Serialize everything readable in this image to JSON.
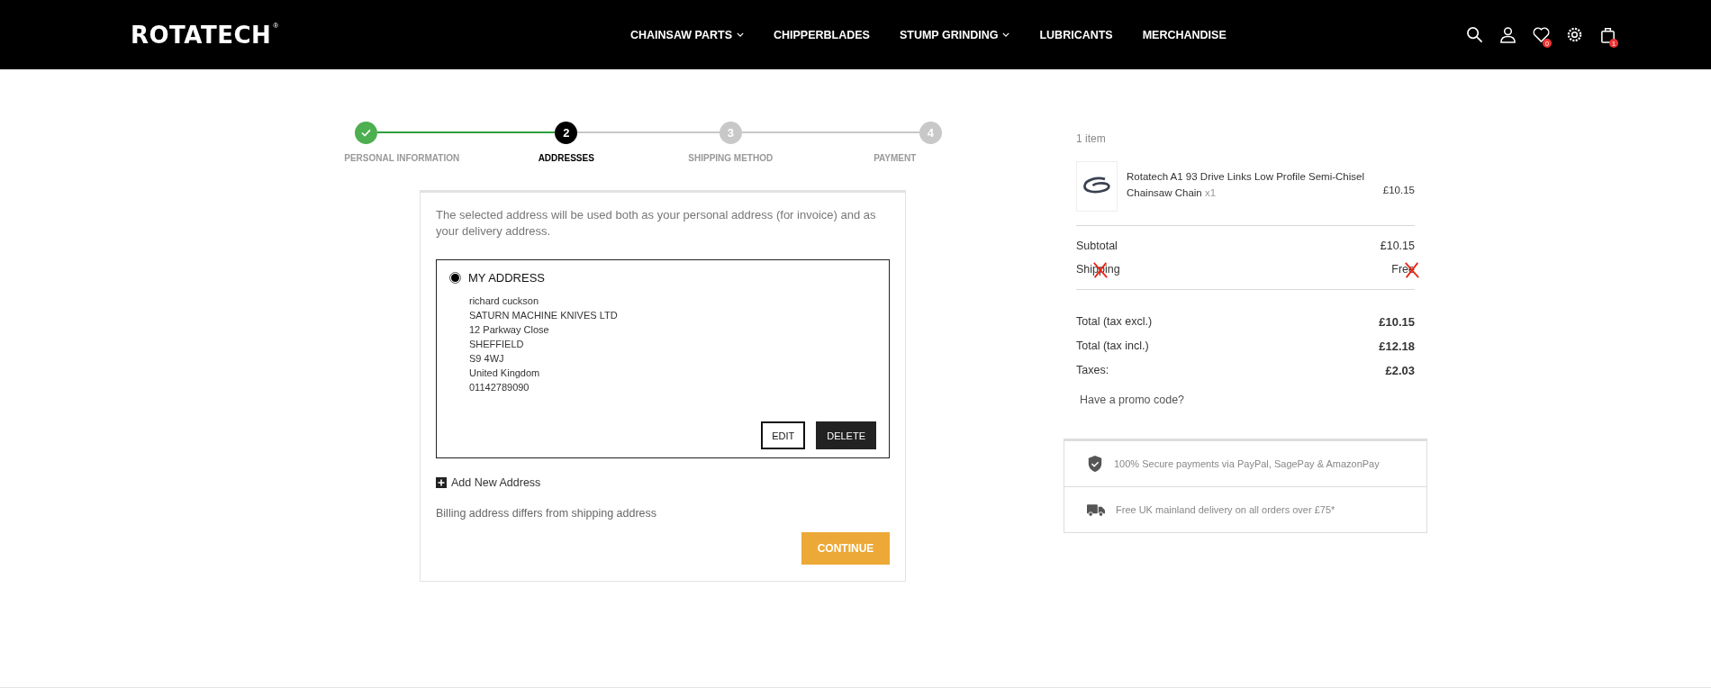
{
  "header": {
    "logo": "ROTATECH",
    "logo_mark": "®",
    "nav": [
      {
        "label": "CHAINSAW PARTS",
        "has_dropdown": true
      },
      {
        "label": "CHIPPERBLADES",
        "has_dropdown": false
      },
      {
        "label": "STUMP GRINDING",
        "has_dropdown": true
      },
      {
        "label": "LUBRICANTS",
        "has_dropdown": false
      },
      {
        "label": "MERCHANDISE",
        "has_dropdown": false
      }
    ],
    "wishlist_badge": "0",
    "cart_badge": "1"
  },
  "steps": [
    {
      "label": "PERSONAL INFORMATION",
      "done": true,
      "selected": false
    },
    {
      "number": "2",
      "label": "ADDRESSES",
      "done": false,
      "selected": true
    },
    {
      "number": "3",
      "label": "SHIPPING METHOD",
      "done": false,
      "selected": false
    },
    {
      "number": "4",
      "label": "PAYMENT",
      "done": false,
      "selected": false
    }
  ],
  "address_section": {
    "intro": "The selected address will be used both as your personal address (for invoice) and as your delivery address.",
    "address": {
      "title": "MY ADDRESS",
      "selected": true,
      "lines": [
        "richard cuckson",
        "SATURN MACHINE KNIVES LTD",
        "12 Parkway Close",
        "SHEFFIELD",
        "S9 4WJ",
        "United Kingdom",
        "01142789090"
      ],
      "buttons": [
        {
          "label": "EDIT",
          "kind": "outline"
        },
        {
          "label": "DELETE",
          "kind": "solid"
        }
      ]
    },
    "add_new": "Add New Address",
    "billing_link": "Billing address differs from shipping address",
    "continue": "CONTINUE"
  },
  "summary": {
    "count": "1 item",
    "product": {
      "name": "Rotatech A1 93 Drive Links Low Profile Semi-Chisel Chainsaw Chain",
      "qty": "x1",
      "price": "£10.15"
    },
    "lines": [
      {
        "label": "Subtotal",
        "value": "£10.15",
        "crossed": false
      },
      {
        "label": "Shipping",
        "value": "Free",
        "crossed": true
      }
    ],
    "totals": [
      {
        "label": "Total (tax excl.)",
        "value": "£10.15"
      },
      {
        "label": "Total (tax incl.)",
        "value": "£12.18"
      },
      {
        "label": "Taxes:",
        "value": "£2.03"
      }
    ],
    "promo": "Have a promo code?"
  },
  "assurances": [
    {
      "kind": "shield",
      "text": "100% Secure payments via PayPal, SagePay & AmazonPay"
    },
    {
      "kind": "truck",
      "text": "Free UK mainland delivery on all orders over £75*"
    }
  ]
}
